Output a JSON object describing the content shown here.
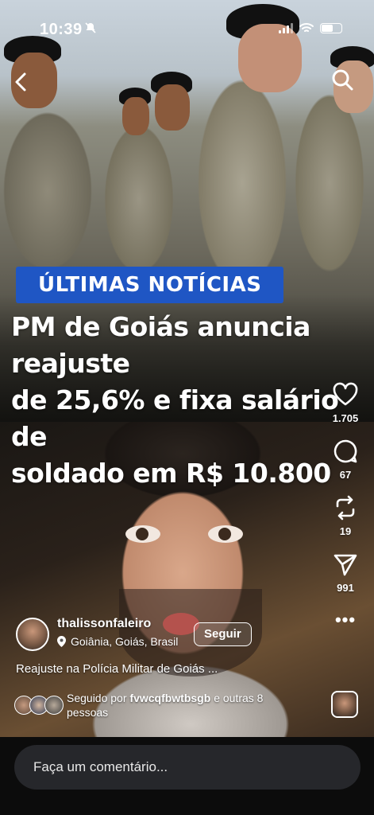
{
  "status_bar": {
    "time": "10:39"
  },
  "news": {
    "badge": "ÚLTIMAS NOTÍCIAS",
    "headline_lines": [
      "PM de Goiás anuncia reajuste",
      "de 25,6% e fixa salário de",
      "soldado em R$ 10.800"
    ]
  },
  "actions": {
    "likes": "1.705",
    "comments": "67",
    "reposts": "19",
    "shares": "991"
  },
  "author": {
    "username": "thalissonfaleiro",
    "location": "Goiânia, Goiás, Brasil",
    "follow_label": "Seguir"
  },
  "caption": "Reajuste na Polícia Militar de Goiás ...",
  "followed_by": {
    "prefix": "Seguido por",
    "user": "fvwcqfbwtbsgb",
    "suffix": "e outras 8 pessoas"
  },
  "comment_bar": {
    "placeholder": "Faça um comentário..."
  },
  "icons": {
    "back": "chevron-left-icon",
    "search": "search-icon",
    "like": "heart-icon",
    "comment": "comment-icon",
    "repost": "repost-icon",
    "share": "send-icon",
    "more": "more-icon",
    "location": "location-pin-icon"
  },
  "colors": {
    "badge": "#1f56c4",
    "background": "#000000",
    "comment_bar": "#26272b"
  }
}
